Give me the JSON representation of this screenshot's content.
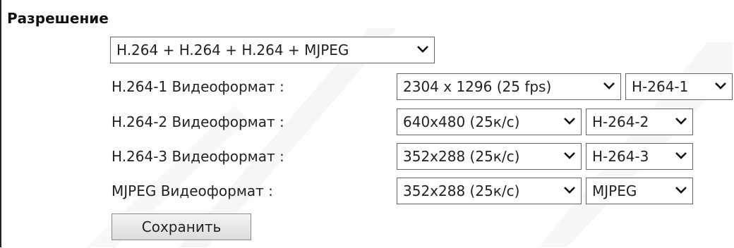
{
  "section": {
    "title": "Разрешение"
  },
  "stream_mode": {
    "selected": "H.264 + H.264 + H.264 + MJPEG"
  },
  "rows": [
    {
      "label": "H.264-1 Видеоформат :",
      "resolution": "2304 x 1296 (25 fps)",
      "stream": "H-264-1"
    },
    {
      "label": "H.264-2 Видеоформат :",
      "resolution": "640x480 (25к/с)",
      "stream": "H-264-2"
    },
    {
      "label": "H.264-3 Видеоформат :",
      "resolution": "352x288 (25к/с)",
      "stream": "H-264-3"
    },
    {
      "label": "MJPEG Видеоформат :",
      "resolution": "352x288 (25к/с)",
      "stream": "MJPEG"
    }
  ],
  "actions": {
    "save_label": "Сохранить"
  },
  "icons": {
    "dropdown": "chevron-down-icon"
  },
  "colors": {
    "border": "#666666",
    "text": "#222222",
    "button_bg": "#e6e6e6"
  }
}
